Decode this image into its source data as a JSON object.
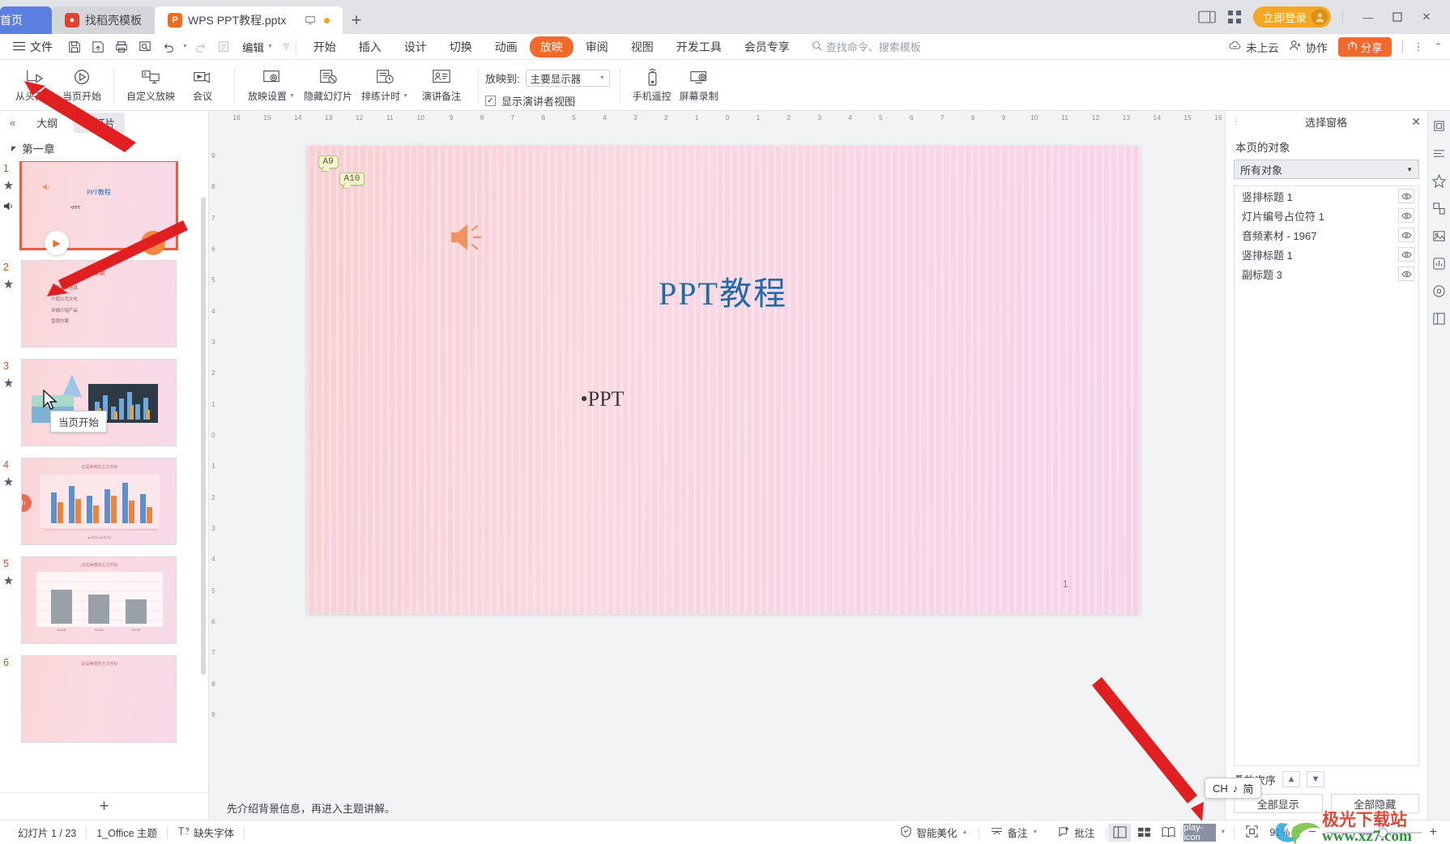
{
  "titlebar": {
    "tabs": [
      {
        "label": "首页",
        "type": "home"
      },
      {
        "label": "找稻壳模板",
        "type": "gray",
        "icon": "docer-icon"
      },
      {
        "label": "WPS PPT教程.pptx",
        "type": "active",
        "icon": "wps-ppt-icon"
      }
    ],
    "new_tab": "+",
    "view_toggle_icon": "split-view-icon",
    "grid_icon": "grid-apps-icon",
    "login_label": "立即登录",
    "avatar_icon": "user-avatar-icon",
    "minimize": "—",
    "maximize": "▢",
    "close": "✕"
  },
  "menubar": {
    "file_label": "文件",
    "hamburger_icon": "hamburger-icon",
    "quick_icons": [
      "save-icon",
      "save-as-cloud-icon",
      "print-icon",
      "print-preview-icon",
      "undo-icon",
      "redo-icon",
      "format-painter-icon"
    ],
    "edit_label": "编辑",
    "tabs": [
      {
        "label": "开始",
        "selected": false
      },
      {
        "label": "插入",
        "selected": false
      },
      {
        "label": "设计",
        "selected": false
      },
      {
        "label": "切换",
        "selected": false
      },
      {
        "label": "动画",
        "selected": false
      },
      {
        "label": "放映",
        "selected": true
      },
      {
        "label": "审阅",
        "selected": false
      },
      {
        "label": "视图",
        "selected": false
      },
      {
        "label": "开发工具",
        "selected": false
      },
      {
        "label": "会员专享",
        "selected": false
      }
    ],
    "search_placeholder": "查找命令、搜索模板",
    "cloud_status": "未上云",
    "collab": "协作",
    "share": "分享",
    "more_icon": "more-vertical-icon",
    "collapse_icon": "chevron-up-icon"
  },
  "ribbon": {
    "groups": [
      {
        "buttons": [
          {
            "label": "从头开始",
            "icon": "play-from-start-icon",
            "dropdown": false
          },
          {
            "label": "当页开始",
            "icon": "play-from-current-icon",
            "dropdown": false
          }
        ]
      },
      {
        "buttons": [
          {
            "label": "自定义放映",
            "icon": "custom-show-icon",
            "dropdown": false
          },
          {
            "label": "会议",
            "icon": "meeting-icon",
            "dropdown": false
          }
        ]
      },
      {
        "buttons": [
          {
            "label": "放映设置",
            "icon": "show-settings-icon",
            "dropdown": true
          },
          {
            "label": "隐藏幻灯片",
            "icon": "hide-slide-icon",
            "dropdown": false
          },
          {
            "label": "排练计时",
            "icon": "rehearse-timing-icon",
            "dropdown": true
          },
          {
            "label": "演讲备注",
            "icon": "speaker-notes-icon",
            "dropdown": false
          }
        ]
      }
    ],
    "projection_label": "放映到:",
    "projection_value": "主要显示器",
    "presenter_view_label": "显示演讲者视图",
    "presenter_view_checked": true,
    "right_buttons": [
      {
        "label": "手机遥控",
        "icon": "phone-remote-icon"
      },
      {
        "label": "屏幕录制",
        "icon": "screen-record-icon"
      }
    ]
  },
  "thumbpane": {
    "collapse_icon": "double-chevron-left-icon",
    "tabs": [
      {
        "label": "大纲",
        "active": false
      },
      {
        "label": "幻灯片",
        "active": true
      }
    ],
    "chapter": "第一章",
    "slides": [
      {
        "number": "1",
        "selected": true,
        "title": "PPT教程",
        "sub": "•PPT",
        "marks": [
          "star",
          "audio"
        ]
      },
      {
        "number": "2",
        "selected": false,
        "title": "目录",
        "bullets": [
          "介绍基本信息",
          "介绍公司文化",
          "详细介绍产品",
          "营销方案"
        ],
        "marks": [
          "star"
        ]
      },
      {
        "number": "3",
        "selected": false,
        "marks": [
          "star"
        ]
      },
      {
        "number": "4",
        "selected": false,
        "marks": [
          "star"
        ]
      },
      {
        "number": "5",
        "selected": false,
        "marks": [
          "star"
        ]
      },
      {
        "number": "6",
        "selected": false,
        "marks": []
      }
    ],
    "tooltip": "当页开始",
    "add_slide": "+"
  },
  "canvas": {
    "h_ruler": [
      "16",
      "15",
      "14",
      "13",
      "12",
      "11",
      "10",
      "9",
      "8",
      "7",
      "6",
      "5",
      "4",
      "3",
      "2",
      "1",
      "0",
      "1",
      "2",
      "3",
      "4",
      "5",
      "6",
      "7",
      "8",
      "9",
      "10",
      "11",
      "12",
      "13",
      "14",
      "15",
      "16"
    ],
    "v_ruler": [
      "9",
      "8",
      "7",
      "6",
      "5",
      "4",
      "3",
      "2",
      "1",
      "0",
      "1",
      "2",
      "3",
      "4",
      "5",
      "6",
      "7",
      "8",
      "9"
    ],
    "comments": [
      {
        "label": "A9"
      },
      {
        "label": "A10"
      }
    ],
    "audio_icon": "speaker-icon",
    "title": "PPT教程",
    "subtitle": "•PPT",
    "page_number": "1",
    "notes_text": "先介绍背景信息，再进入主题讲解。"
  },
  "selection_pane": {
    "title": "选择窗格",
    "close_icon": "close-icon",
    "section_label": "本页的对象",
    "filter_value": "所有对象",
    "items": [
      {
        "label": "竖排标题 1",
        "visible": true
      },
      {
        "label": "灯片编号占位符 1",
        "visible": true
      },
      {
        "label": "音频素材 - 1967",
        "visible": true
      },
      {
        "label": "竖排标题 1",
        "visible": true
      },
      {
        "label": "副标题 3",
        "visible": true
      }
    ],
    "order_label": "叠放次序",
    "up_icon": "arrow-up-icon",
    "down_icon": "arrow-down-icon",
    "show_all": "全部显示",
    "hide_all": "全部隐藏"
  },
  "rail_icons": [
    "shape-tools-icon",
    "format-icon",
    "animation-pane-icon",
    "design-ideas-icon",
    "picture-icon",
    "chart-icon",
    "smart-icon",
    "layout-icon"
  ],
  "statusbar": {
    "slide_count": "幻灯片 1 / 23",
    "theme": "1_Office 主题",
    "missing_font": "缺失字体",
    "missing_font_icon": "font-warning-icon",
    "beautify": "智能美化",
    "notes": "备注",
    "comments": "批注",
    "view_normal_icon": "view-normal-icon",
    "view_sorter_icon": "view-sorter-icon",
    "view_reading_icon": "view-reading-icon",
    "play_icon": "play-icon",
    "fit_icon": "fit-slide-icon",
    "zoom_value": "91%",
    "zoom_out": "−",
    "zoom_in": "+"
  },
  "ime": {
    "lang": "CH",
    "audio_icon": "music-note-icon",
    "mode": "简"
  },
  "watermark": {
    "line1": "极光下载站",
    "line2": "www.xz7.com"
  },
  "colors": {
    "accent_orange": "#f2692e",
    "login_amber": "#f5a623",
    "home_blue": "#5b7fe0",
    "title_blue": "#1f6aa8",
    "annotation_red": "#e02020"
  }
}
